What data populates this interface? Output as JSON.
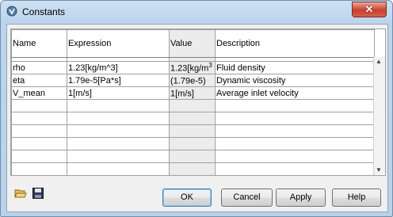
{
  "window": {
    "title": "Constants",
    "close_label": "✕"
  },
  "table": {
    "columns": [
      "Name",
      "Expression",
      "Value",
      "Description"
    ],
    "rows": [
      {
        "name": "rho",
        "expression": "1.23[kg/m^3]",
        "value": "1.23[kg/m",
        "value_sup": "3",
        "description": "Fluid density"
      },
      {
        "name": "eta",
        "expression": "1.79e-5[Pa*s]",
        "value": "(1.79e-5)",
        "value_sup": "",
        "description": "Dynamic viscosity"
      },
      {
        "name": "V_mean",
        "expression": "1[m/s]",
        "value": "1[m/s]",
        "value_sup": "",
        "description": "Average inlet velocity"
      }
    ],
    "empty_rows": 8
  },
  "toolbar": {
    "open_icon": "folder-open-icon",
    "save_icon": "save-icon"
  },
  "buttons": {
    "ok": "OK",
    "cancel": "Cancel",
    "apply": "Apply",
    "help": "Help"
  }
}
